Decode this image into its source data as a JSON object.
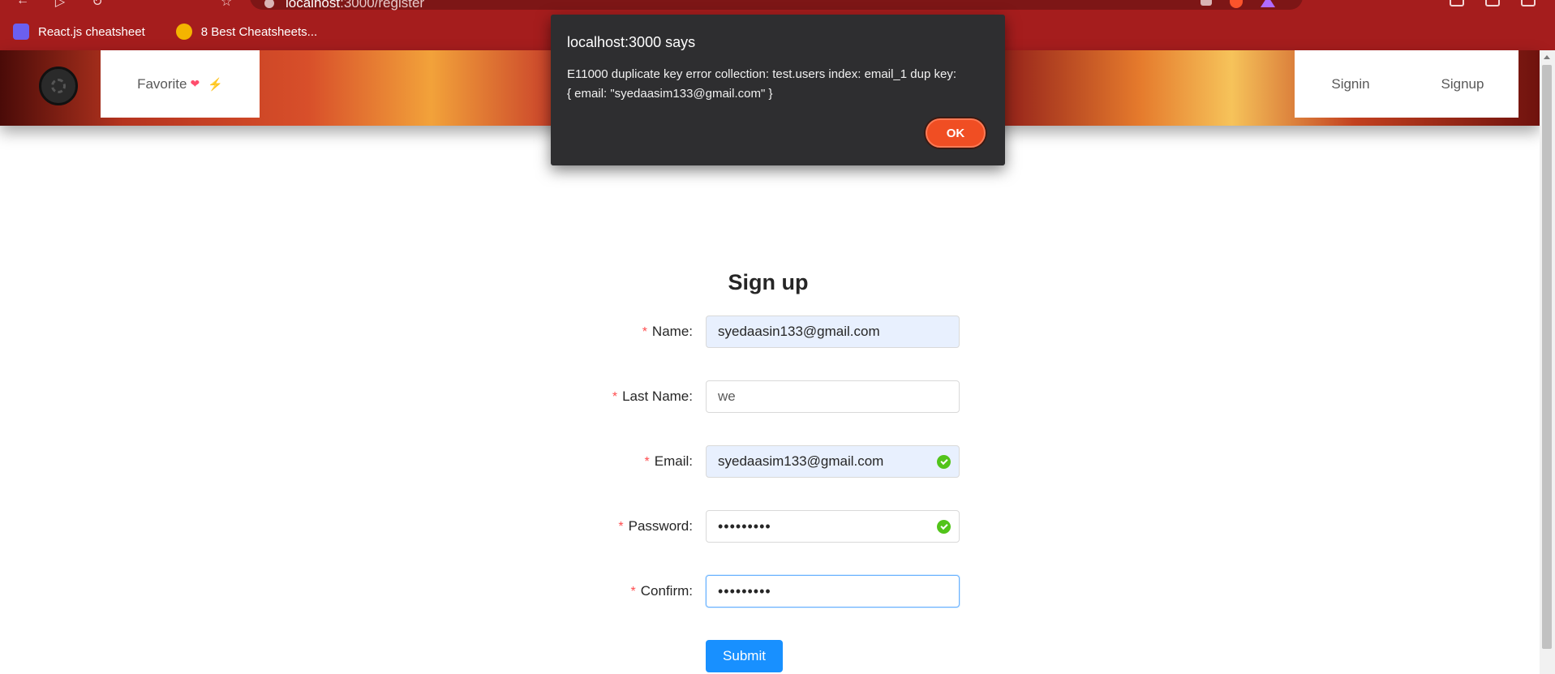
{
  "browser": {
    "url_host": "localhost",
    "url_path": ":3000/register",
    "bookmarks": [
      {
        "label": "React.js cheatsheet"
      },
      {
        "label": "8 Best Cheatsheets..."
      }
    ]
  },
  "header": {
    "nav_left": {
      "label": "Favorite"
    },
    "nav_right": [
      {
        "label": "Signin"
      },
      {
        "label": "Signup"
      }
    ]
  },
  "form": {
    "title": "Sign up",
    "required_mark": "*",
    "fields": {
      "name": {
        "label": "Name:",
        "value": "syedaasin133@gmail.com"
      },
      "last_name": {
        "label": "Last Name:",
        "value": "we"
      },
      "email": {
        "label": "Email:",
        "value": "syedaasim133@gmail.com"
      },
      "password": {
        "label": "Password:",
        "value": "•••••••••"
      },
      "confirm": {
        "label": "Confirm:",
        "value": "•••••••••"
      }
    },
    "submit_label": "Submit"
  },
  "alert": {
    "title": "localhost:3000 says",
    "message_line1": "E11000 duplicate key error collection: test.users index: email_1 dup key:",
    "message_line2": "{ email: \"syedaasim133@gmail.com\" }",
    "ok_label": "OK"
  },
  "colors": {
    "browser_red": "#a51d1d",
    "primary_blue": "#1890ff",
    "success_green": "#52c41a",
    "required_red": "#ff4d4f",
    "dialog_bg": "#2e2e30",
    "ok_orange": "#f04e23"
  }
}
